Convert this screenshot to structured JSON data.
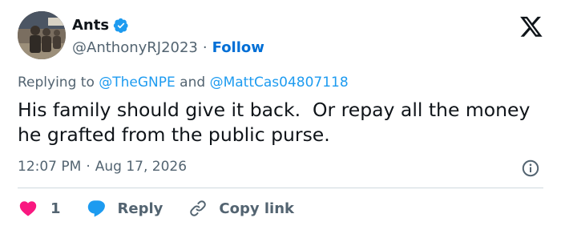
{
  "author": {
    "display_name": "Ants",
    "handle": "@AnthonyRJ2023",
    "separator": "·",
    "follow_label": "Follow",
    "avatar_icon": "avatar-photo",
    "verified_icon": "verified-badge-icon",
    "verified_color": "#1d9bf0"
  },
  "platform": {
    "logo_icon": "x-logo-icon"
  },
  "tweet": {
    "replying_prefix": "Replying to",
    "mention_1": "@TheGNPE",
    "conjunction": "and",
    "mention_2": "@MattCas04807118",
    "text": "His family should give it back.  Or repay all the money he grafted from the public purse.",
    "time": "12:07 PM",
    "meta_separator": "·",
    "date": "Aug 17, 2026",
    "info_icon": "info-icon"
  },
  "actions": {
    "like_icon": "heart-icon",
    "like_count": "1",
    "like_color": "#f91880",
    "reply_icon": "reply-bubble-icon",
    "reply_label": "Reply",
    "reply_color": "#1d9bf0",
    "copy_icon": "link-icon",
    "copy_label": "Copy link"
  }
}
